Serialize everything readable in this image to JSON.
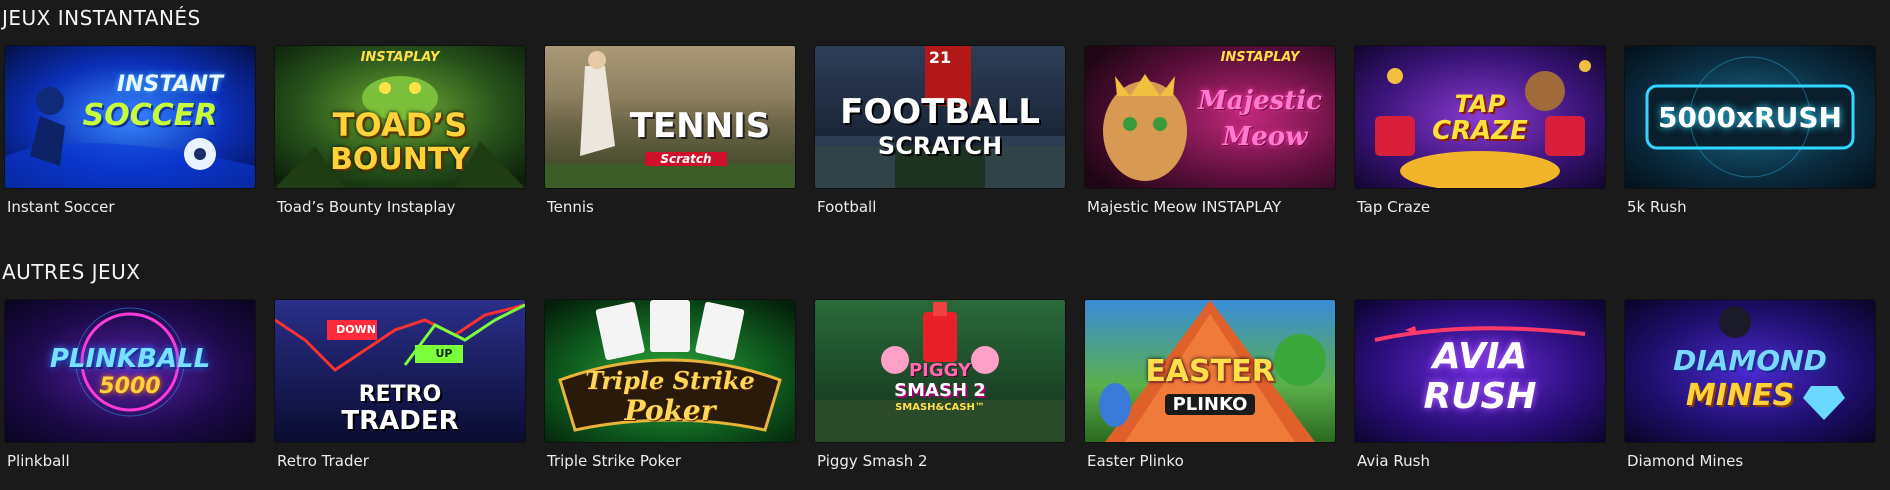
{
  "sections": [
    {
      "title": "JEUX INSTANTANÉS",
      "games": [
        {
          "label": "Instant Soccer",
          "art": [
            "INSTANT",
            "SOCCER"
          ]
        },
        {
          "label": "Toad’s Bounty Instaplay",
          "art": [
            "INSTAPLAY",
            "TOAD’S",
            "BOUNTY"
          ]
        },
        {
          "label": "Tennis",
          "art": [
            "TENNIS",
            "Scratch"
          ]
        },
        {
          "label": "Football",
          "art": [
            "FOOTBALL",
            "SCRATCH",
            "21"
          ]
        },
        {
          "label": "Majestic Meow INSTAPLAY",
          "art": [
            "INSTAPLAY",
            "Majestic",
            "Meow"
          ]
        },
        {
          "label": "Tap Craze",
          "art": [
            "TAP",
            "CRAZE"
          ]
        },
        {
          "label": "5k Rush",
          "art": [
            "5000xRUSH"
          ]
        }
      ]
    },
    {
      "title": "AUTRES JEUX",
      "games": [
        {
          "label": "Plinkball",
          "art": [
            "PLINKBALL",
            "5000"
          ]
        },
        {
          "label": "Retro Trader",
          "art": [
            "DOWN",
            "UP",
            "RETRO",
            "TRADER"
          ]
        },
        {
          "label": "Triple Strike Poker",
          "art": [
            "Triple Strike",
            "Poker"
          ]
        },
        {
          "label": "Piggy Smash 2",
          "art": [
            "PIGGY",
            "SMASH 2",
            "SMASH&CASH™"
          ]
        },
        {
          "label": "Easter Plinko",
          "art": [
            "EASTER",
            "PLINKO"
          ]
        },
        {
          "label": "Avia Rush",
          "art": [
            "AVIA",
            "RUSH"
          ]
        },
        {
          "label": "Diamond Mines",
          "art": [
            "DIAMOND",
            "MINES"
          ]
        }
      ]
    }
  ],
  "colors": {
    "background": "#1a1a1a",
    "text": "#f2f2f2"
  }
}
